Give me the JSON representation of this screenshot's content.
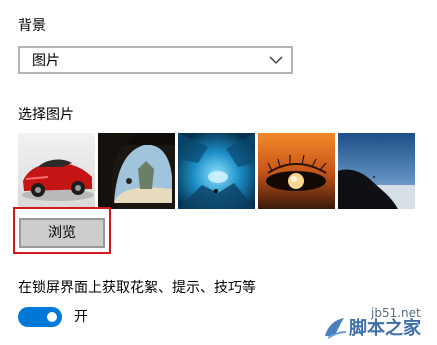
{
  "background": {
    "label": "背景",
    "selected": "图片"
  },
  "picture": {
    "label": "选择图片",
    "thumbnails": [
      {
        "name": "red-sports-car"
      },
      {
        "name": "cave-beach"
      },
      {
        "name": "ice-cave"
      },
      {
        "name": "eye-at-sunset"
      },
      {
        "name": "mountain-horizon"
      }
    ],
    "browse_label": "浏览"
  },
  "spotlight": {
    "label": "在锁屏界面上获取花絮、提示、技巧等",
    "toggle_label": "开",
    "toggle_on": true
  },
  "watermark": {
    "url": "jb51.net",
    "name": "脚本之家"
  },
  "colors": {
    "accent": "#0078d7",
    "highlight_border": "#d11a1a"
  }
}
